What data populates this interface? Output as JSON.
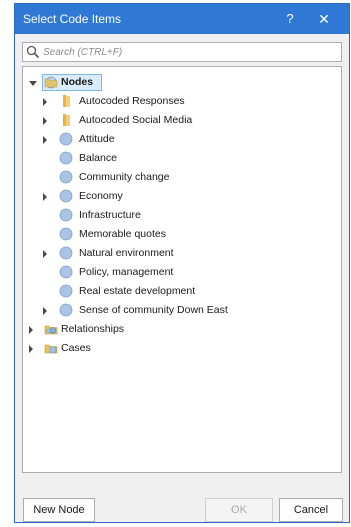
{
  "window": {
    "title": "Select Code Items",
    "help_label": "?",
    "close_label": "✕"
  },
  "search": {
    "placeholder": "Search (CTRL+F)",
    "value": ""
  },
  "tree": {
    "root": {
      "label": "Nodes",
      "expanded": true,
      "selected": true,
      "icon": "nodes-folder-icon"
    },
    "children": [
      {
        "label": "Autocoded Responses",
        "has_children": true,
        "icon": "folder-icon"
      },
      {
        "label": "Autocoded Social Media",
        "has_children": true,
        "icon": "folder-icon"
      },
      {
        "label": "Attitude",
        "has_children": true,
        "icon": "node-icon"
      },
      {
        "label": "Balance",
        "has_children": false,
        "icon": "node-icon"
      },
      {
        "label": "Community change",
        "has_children": false,
        "icon": "node-icon"
      },
      {
        "label": "Economy",
        "has_children": true,
        "icon": "node-icon"
      },
      {
        "label": "Infrastructure",
        "has_children": false,
        "icon": "node-icon"
      },
      {
        "label": "Memorable quotes",
        "has_children": false,
        "icon": "node-icon"
      },
      {
        "label": "Natural environment",
        "has_children": true,
        "icon": "node-icon"
      },
      {
        "label": "Policy, management",
        "has_children": false,
        "icon": "node-icon"
      },
      {
        "label": "Real estate development",
        "has_children": false,
        "icon": "node-icon"
      },
      {
        "label": "Sense of community Down East",
        "has_children": true,
        "icon": "node-icon"
      }
    ],
    "siblings": [
      {
        "label": "Relationships",
        "has_children": true,
        "icon": "relationships-icon"
      },
      {
        "label": "Cases",
        "has_children": true,
        "icon": "cases-icon"
      }
    ]
  },
  "buttons": {
    "new_node": "New Node",
    "ok": "OK",
    "cancel": "Cancel"
  },
  "colors": {
    "titlebar": "#2f78d6",
    "selection": "#d9ecfb",
    "node_icon": "#a9c4e4",
    "folder_icon": "#e8b44a"
  }
}
